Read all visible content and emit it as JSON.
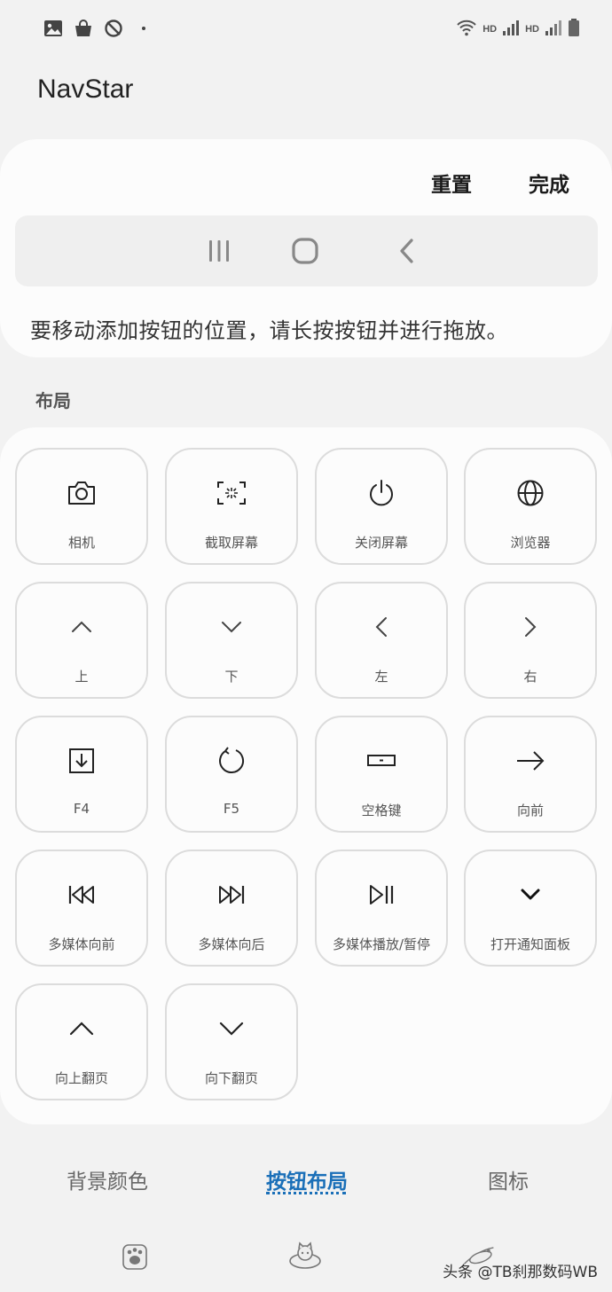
{
  "status_bar": {
    "left_icons": [
      "image-icon",
      "shopping-bag-icon",
      "blocked-sync-icon"
    ],
    "hd_1": "HD",
    "hd_2": "HD"
  },
  "app": {
    "title": "NavStar"
  },
  "preview": {
    "reset_label": "重置",
    "done_label": "完成",
    "instructions": "要移动添加按钮的位置，请长按按钮并进行拖放。",
    "nav_buttons": [
      "recent-apps-icon",
      "home-icon",
      "back-icon"
    ]
  },
  "section": {
    "label": "布局"
  },
  "buttons": [
    {
      "label": "相机",
      "icon": "camera-icon"
    },
    {
      "label": "截取屏幕",
      "icon": "screenshot-icon"
    },
    {
      "label": "关闭屏幕",
      "icon": "power-icon"
    },
    {
      "label": "浏览器",
      "icon": "globe-icon"
    },
    {
      "label": "上",
      "icon": "chevron-up-icon"
    },
    {
      "label": "下",
      "icon": "chevron-down-icon"
    },
    {
      "label": "左",
      "icon": "chevron-left-icon"
    },
    {
      "label": "右",
      "icon": "chevron-right-icon"
    },
    {
      "label": "F4",
      "icon": "download-box-icon"
    },
    {
      "label": "F5",
      "icon": "refresh-icon"
    },
    {
      "label": "空格键",
      "icon": "spacebar-icon"
    },
    {
      "label": "向前",
      "icon": "arrow-right-icon"
    },
    {
      "label": "多媒体向前",
      "icon": "skip-previous-icon"
    },
    {
      "label": "多媒体向后",
      "icon": "skip-next-icon"
    },
    {
      "label": "多媒体播放/暂停",
      "icon": "play-pause-icon"
    },
    {
      "label": "打开通知面板",
      "icon": "chevron-down-bold-icon"
    },
    {
      "label": "向上翻页",
      "icon": "page-up-icon"
    },
    {
      "label": "向下翻页",
      "icon": "page-down-icon"
    }
  ],
  "tabs": [
    {
      "label": "背景颜色",
      "active": false
    },
    {
      "label": "按钮布局",
      "active": true
    },
    {
      "label": "图标",
      "active": false
    }
  ],
  "watermark": "头条 @TB刹那数码WB",
  "colors": {
    "accent": "#1a6fb8",
    "panel": "#fcfcfc",
    "background": "#f2f2f2"
  }
}
